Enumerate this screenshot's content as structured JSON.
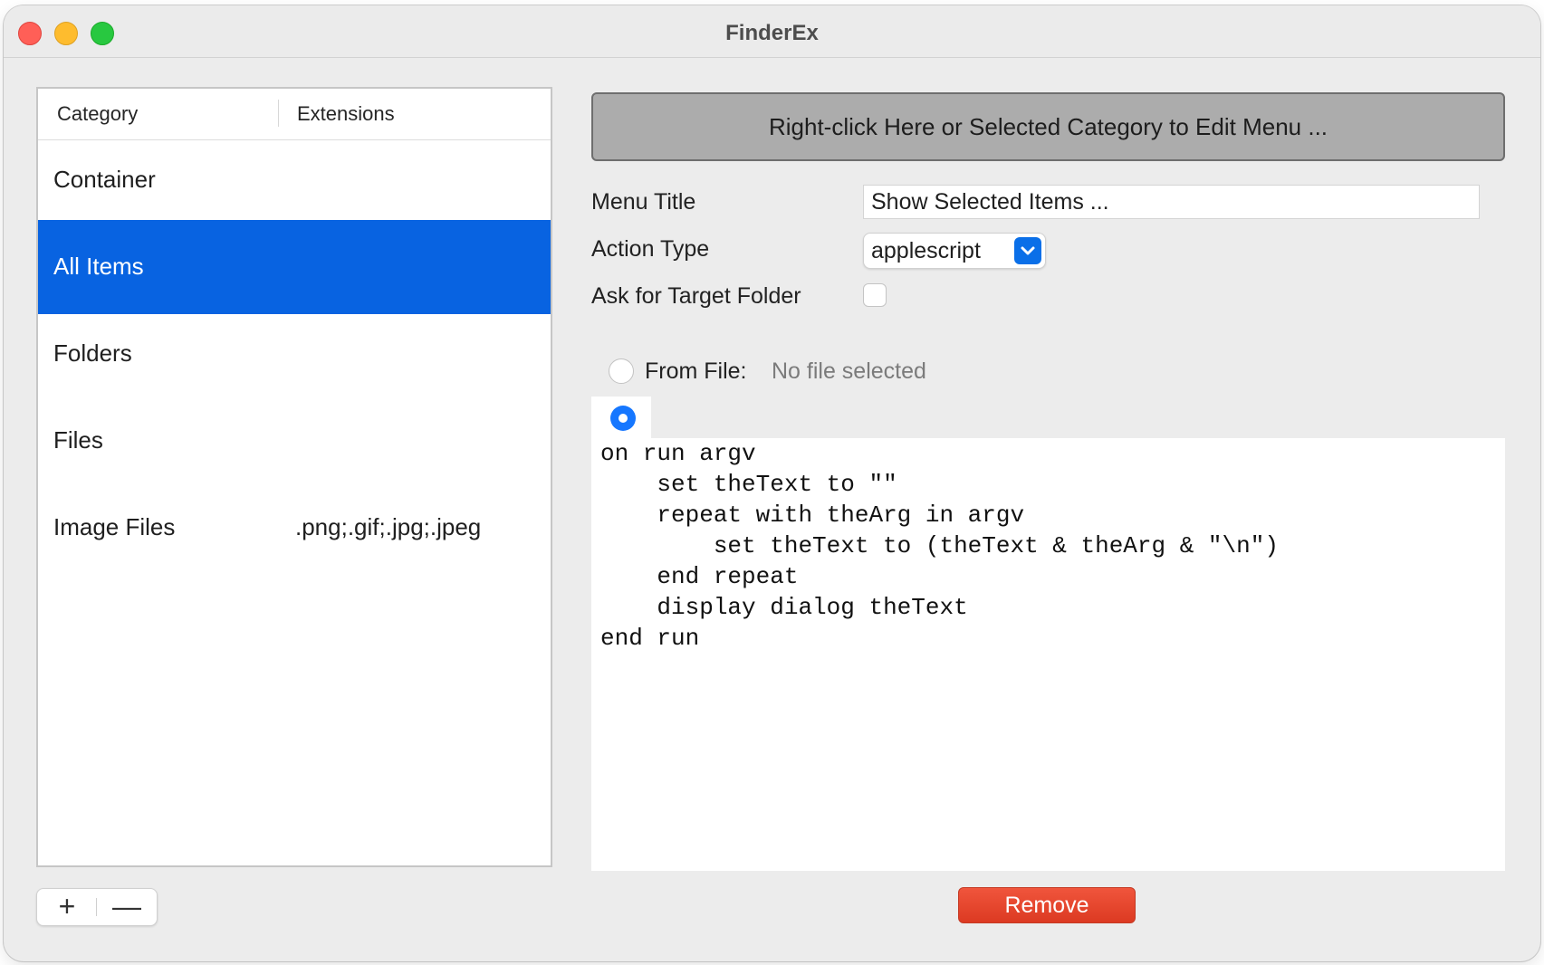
{
  "window": {
    "title": "FinderEx"
  },
  "table": {
    "headers": {
      "category": "Category",
      "extensions": "Extensions"
    },
    "rows": [
      {
        "category": "Container",
        "extensions": "",
        "selected": false
      },
      {
        "category": "All Items",
        "extensions": "",
        "selected": true
      },
      {
        "category": "Folders",
        "extensions": "",
        "selected": false
      },
      {
        "category": "Files",
        "extensions": "",
        "selected": false
      },
      {
        "category": "Image Files",
        "extensions": ".png;.gif;.jpg;.jpeg",
        "selected": false
      }
    ]
  },
  "buttons": {
    "add": "+",
    "remove_category": "—",
    "remove": "Remove"
  },
  "edit_bar": {
    "label": "Right-click Here or Selected Category to Edit Menu ..."
  },
  "form": {
    "menu_title_label": "Menu Title",
    "menu_title_value": "Show Selected Items ...",
    "action_type_label": "Action Type",
    "action_type_value": "applescript",
    "ask_folder_label": "Ask for Target Folder",
    "ask_folder_checked": false
  },
  "source": {
    "from_file_label": "From File:",
    "file_status": "No file selected",
    "from_file_selected": false,
    "inline_selected": true,
    "code": "on run argv\n\tset theText to \"\"\n\trepeat with theArg in argv\n\t\tset theText to (theText & theArg & \"\\n\")\n\tend repeat\n\tdisplay dialog theText\nend run"
  },
  "colors": {
    "selection": "#0863e1",
    "accent": "#0a6fe8",
    "remove_button": "#e2412a",
    "edit_bar": "#acacac"
  }
}
